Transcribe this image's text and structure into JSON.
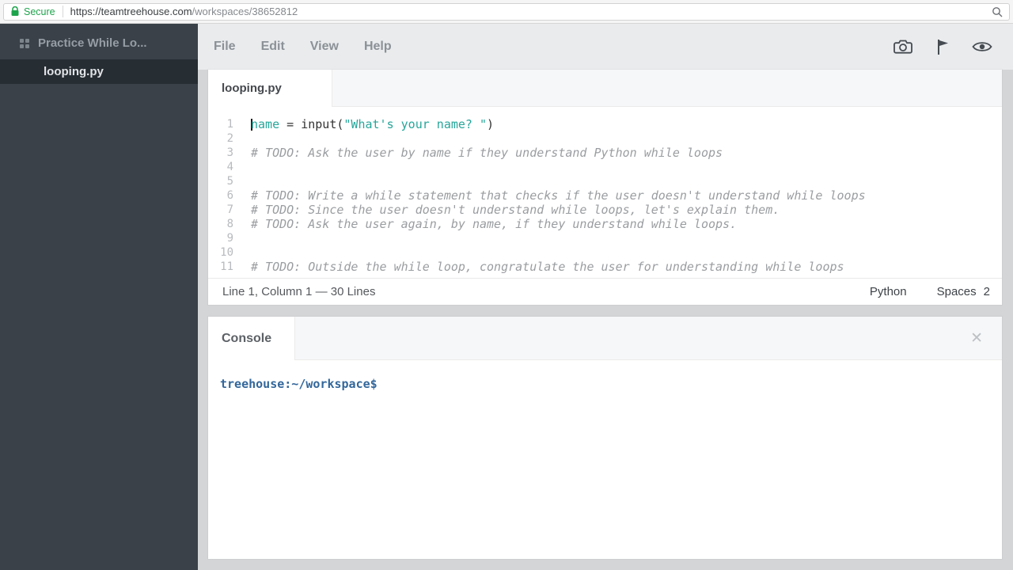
{
  "browser": {
    "secure_label": "Secure",
    "url_main": "https://teamtreehouse.com",
    "url_path": "/workspaces/38652812"
  },
  "sidebar": {
    "project_name": "Practice While Lo...",
    "file_name": "looping.py"
  },
  "menubar": {
    "items": [
      "File",
      "Edit",
      "View",
      "Help"
    ]
  },
  "editor": {
    "tab_label": "looping.py",
    "cursor": {
      "line": "1",
      "column": "1"
    },
    "lines": [
      {
        "n": "1",
        "segments": [
          {
            "t": "var",
            "text": "name"
          },
          {
            "t": "plain",
            "text": " = input("
          },
          {
            "t": "str",
            "text": "\"What's your name? \""
          },
          {
            "t": "plain",
            "text": ")"
          }
        ]
      },
      {
        "n": "2",
        "segments": []
      },
      {
        "n": "3",
        "segments": [
          {
            "t": "comment",
            "text": "# TODO: Ask the user by name if they understand Python while loops"
          }
        ]
      },
      {
        "n": "4",
        "segments": []
      },
      {
        "n": "5",
        "segments": []
      },
      {
        "n": "6",
        "segments": [
          {
            "t": "comment",
            "text": "# TODO: Write a while statement that checks if the user doesn't understand while loops"
          }
        ]
      },
      {
        "n": "7",
        "segments": [
          {
            "t": "comment",
            "text": "# TODO: Since the user doesn't understand while loops, let's explain them."
          }
        ]
      },
      {
        "n": "8",
        "segments": [
          {
            "t": "comment",
            "text": "# TODO: Ask the user again, by name, if they understand while loops."
          }
        ]
      },
      {
        "n": "9",
        "segments": []
      },
      {
        "n": "10",
        "segments": []
      },
      {
        "n": "11",
        "segments": [
          {
            "t": "comment",
            "text": "# TODO: Outside the while loop, congratulate the user for understanding while loops"
          }
        ]
      }
    ],
    "status": {
      "left": "Line 1, Column 1 — 30 Lines",
      "language": "Python",
      "indent_label": "Spaces",
      "indent_value": "2"
    }
  },
  "console": {
    "tab_label": "Console",
    "close_glyph": "✕",
    "prompt": "treehouse:~/workspace$"
  },
  "colors": {
    "accent_teal": "#26a69a",
    "secure_green": "#1ea44c",
    "prompt_blue": "#33679b",
    "sidebar_dark": "#3a4149"
  }
}
